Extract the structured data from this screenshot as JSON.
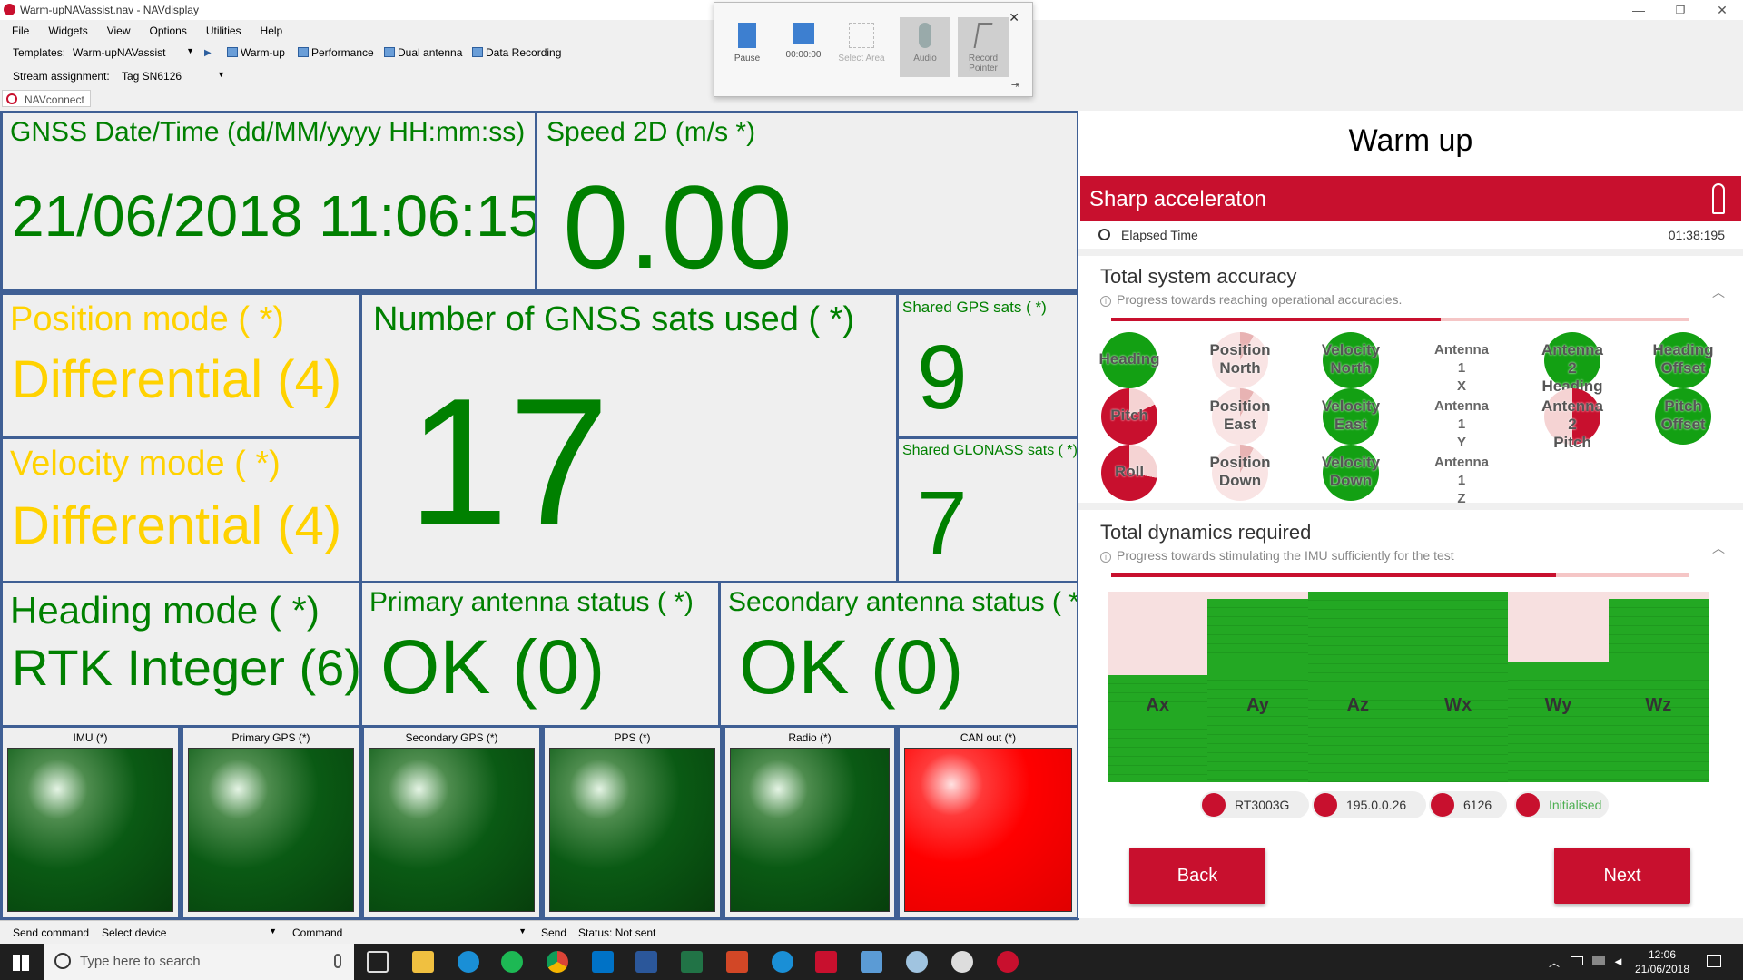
{
  "window": {
    "title": "Warm-upNAVassist.nav - NAVdisplay",
    "min": "—",
    "max": "❐",
    "close": "✕"
  },
  "menu": [
    "File",
    "Widgets",
    "View",
    "Options",
    "Utilities",
    "Help"
  ],
  "toolbar": {
    "templates_label": "Templates:",
    "template_value": "Warm-upNAVassist",
    "items": [
      "Warm-up",
      "Performance",
      "Dual antenna",
      "Data Recording"
    ],
    "stream_label": "Stream assignment:",
    "stream_value": "Tag SN6126"
  },
  "navconnect": "NAVconnect",
  "recorder": {
    "pause": "Pause",
    "timer": "00:00:00",
    "select_area": "Select Area",
    "audio": "Audio",
    "record_pointer": "Record Pointer"
  },
  "dashboard": {
    "gnss_time": {
      "label": "GNSS Date/Time (dd/MM/yyyy HH:mm:ss)",
      "value": "21/06/2018 11:06:15"
    },
    "speed": {
      "label": "Speed 2D (m/s *)",
      "value": "0.00"
    },
    "position_mode": {
      "label": "Position mode ( *)",
      "value": "Differential (4)"
    },
    "sats_used": {
      "label": "Number of GNSS sats used ( *)",
      "value": "17"
    },
    "gps_sats": {
      "label": "Shared GPS sats ( *)",
      "value": "9"
    },
    "glonass_sats": {
      "label": "Shared GLONASS sats ( *)",
      "value": "7"
    },
    "velocity_mode": {
      "label": "Velocity mode ( *)",
      "value": "Differential (4)"
    },
    "heading_mode": {
      "label": "Heading mode ( *)",
      "value": "RTK Integer (6)"
    },
    "primary_antenna": {
      "label": "Primary antenna status ( *)",
      "value": "OK (0)"
    },
    "secondary_antenna": {
      "label": "Secondary antenna status ( *)",
      "value": "OK (0)"
    },
    "leds": [
      {
        "label": "IMU (*)",
        "state": "green"
      },
      {
        "label": "Primary GPS (*)",
        "state": "green"
      },
      {
        "label": "Secondary GPS (*)",
        "state": "green"
      },
      {
        "label": "PPS (*)",
        "state": "green"
      },
      {
        "label": "Radio (*)",
        "state": "green"
      },
      {
        "label": "CAN out (*)",
        "state": "red"
      }
    ]
  },
  "statusbar": {
    "send_command": "Send command",
    "select_device": "Select device",
    "command": "Command",
    "send": "Send",
    "status": "Status: Not sent"
  },
  "warmup": {
    "title": "Warm up",
    "alert": "Sharp acceleraton",
    "elapsed_label": "Elapsed Time",
    "elapsed_value": "01:38:195",
    "accuracy_title": "Total system accuracy",
    "accuracy_sub": "Progress towards reaching operational accuracies.",
    "accuracy_progress": 0.57,
    "accuracy_items": [
      {
        "l1": "Heading",
        "l2": "",
        "style": "gr"
      },
      {
        "l1": "Position",
        "l2": "North",
        "style": "pk"
      },
      {
        "l1": "Velocity",
        "l2": "North",
        "style": "gr"
      },
      {
        "l1": "Antenna 1",
        "l2": "X",
        "style": "plain"
      },
      {
        "l1": "Antenna 2",
        "l2": "Heading",
        "style": "gr"
      },
      {
        "l1": "Heading",
        "l2": "Offset",
        "style": "gr"
      },
      {
        "l1": "Pitch",
        "l2": "",
        "style": "rd"
      },
      {
        "l1": "Position",
        "l2": "East",
        "style": "pk"
      },
      {
        "l1": "Velocity",
        "l2": "East",
        "style": "gr"
      },
      {
        "l1": "Antenna 1",
        "l2": "Y",
        "style": "plain"
      },
      {
        "l1": "Antenna 2",
        "l2": "Pitch",
        "style": "rdh"
      },
      {
        "l1": "Pitch",
        "l2": "Offset",
        "style": "gr"
      },
      {
        "l1": "Roll",
        "l2": "",
        "style": "rd2"
      },
      {
        "l1": "Position",
        "l2": "Down",
        "style": "pk"
      },
      {
        "l1": "Velocity",
        "l2": "Down",
        "style": "gr"
      },
      {
        "l1": "Antenna 1",
        "l2": "Z",
        "style": "plain"
      }
    ],
    "dynamics_title": "Total dynamics required",
    "dynamics_sub": "Progress towards stimulating the IMU sufficiently for the test",
    "dynamics_progress": 0.77,
    "dynamics": [
      {
        "axis": "Ax",
        "level": 0.56
      },
      {
        "axis": "Ay",
        "level": 0.96
      },
      {
        "axis": "Az",
        "level": 1.0
      },
      {
        "axis": "Wx",
        "level": 1.0
      },
      {
        "axis": "Wy",
        "level": 0.63
      },
      {
        "axis": "Wz",
        "level": 0.96
      }
    ],
    "chips": [
      "RT3003G",
      "195.0.0.26",
      "6126",
      "Initialised"
    ],
    "colors": {
      "accent": "#c8102e",
      "ok": "#13a013",
      "initialised": "#4caf50"
    },
    "back": "Back",
    "next": "Next"
  },
  "taskbar": {
    "search_placeholder": "Type here to search",
    "time": "12:06",
    "date": "21/06/2018"
  }
}
